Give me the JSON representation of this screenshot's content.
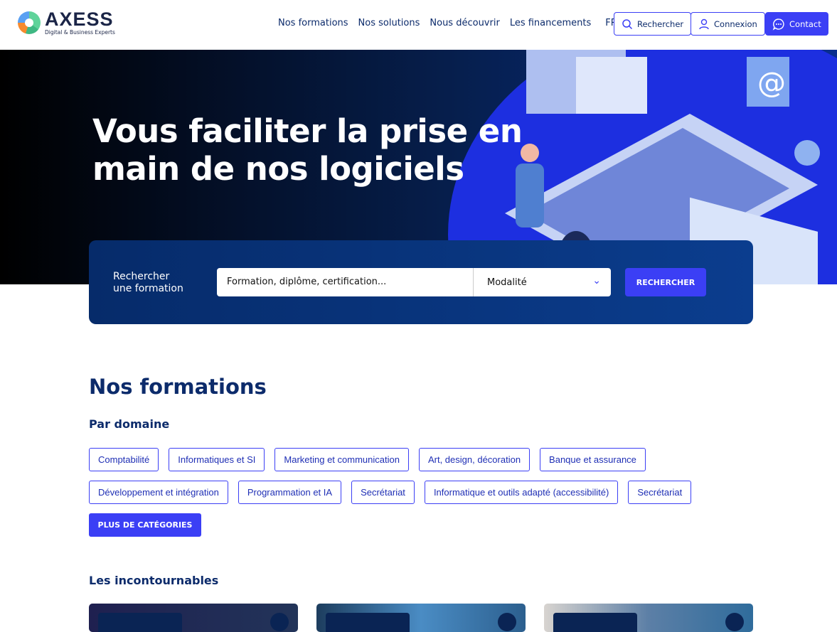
{
  "header": {
    "logo": {
      "title": "AXESS",
      "subtitle": "Digital & Business Experts"
    },
    "nav": [
      "Nos formations",
      "Nos solutions",
      "Nous découvrir",
      "Les financements"
    ],
    "language": "FR",
    "search_label": "Rechercher",
    "login_label": "Connexion",
    "contact_label": "Contact",
    "accent": "#3b3ff5"
  },
  "hero": {
    "title_line1": "Vous faciliter la prise en",
    "title_line2": "main de nos logiciels"
  },
  "search": {
    "label_line1": "Rechercher",
    "label_line2": "une formation",
    "placeholder": "Formation, diplôme, certification...",
    "modality": "Modalité",
    "button": "RECHERCHER"
  },
  "formations": {
    "title": "Nos formations",
    "by_domain": "Par domaine",
    "categories": [
      "Comptabilité",
      "Informatiques et SI",
      "Marketing et communication",
      "Art, design, décoration",
      "Banque et assurance",
      "Développement et intégration",
      "Programmation et IA",
      "Secrétariat",
      "Informatique et outils adapté (accessibilité)",
      "Secrétariat"
    ],
    "more": "PLUS DE CATÉGORIES",
    "essentials": "Les incontournables"
  }
}
